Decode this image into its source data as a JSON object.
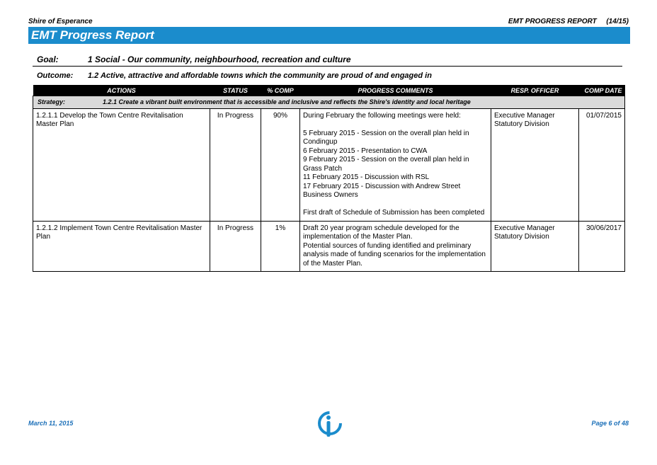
{
  "header": {
    "org": "Shire of Esperance",
    "report": "EMT PROGRESS REPORT",
    "page_ratio": "(14/15)",
    "banner_title": "EMT Progress Report"
  },
  "goal": {
    "label": "Goal:",
    "text": "1 Social - Our community, neighbourhood, recreation and culture"
  },
  "outcome": {
    "label": "Outcome:",
    "text": "1.2 Active, attractive and affordable towns which the community are proud of and engaged in"
  },
  "table": {
    "columns": [
      "ACTIONS",
      "STATUS",
      "% COMP",
      "PROGRESS COMMENTS",
      "RESP. OFFICER",
      "COMP DATE"
    ],
    "strategy_label": "Strategy:",
    "strategy_text": "1.2.1 Create a vibrant built environment that is accessible and inclusive and reflects the Shire's identity and local heritage",
    "rows": [
      {
        "action": "1.2.1.1  Develop the Town Centre Revitalisation Master Plan",
        "status": "In Progress",
        "comp": "90%",
        "comments": [
          "During February the following meetings were held:",
          "",
          "5 February 2015 - Session on the overall plan held in Condingup",
          "6 February 2015 - Presentation to CWA",
          "9 February 2015 -  Session on the overall plan held in Grass Patch",
          "11 February 2015 - Discussion with RSL",
          "17 February 2015 - Discussion with Andrew Street Business Owners",
          "",
          "First draft of Schedule of Submission has been completed"
        ],
        "officer": "Executive Manager Statutory Division",
        "date": "01/07/2015"
      },
      {
        "action": "1.2.1.2  Implement Town Centre Revitalisation Master Plan",
        "status": "In Progress",
        "comp": "1%",
        "comments": [
          "Draft 20 year program schedule developed for the implementation of the Master Plan.",
          "Potential sources of funding identified and preliminary analysis made of funding scenarios for the implementation of the Master Plan."
        ],
        "officer": "Executive Manager Statutory Division",
        "date": "30/06/2017"
      }
    ]
  },
  "footer": {
    "date": "March 11, 2015",
    "page": "Page 6 of 48",
    "logo_icon": "info-logo-icon"
  },
  "colors": {
    "banner": "#1b8ccc",
    "footer_text": "#1b6fb8",
    "strategy_bg": "#d9d9d9"
  }
}
